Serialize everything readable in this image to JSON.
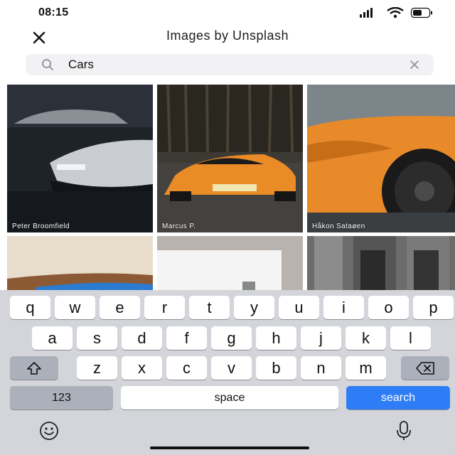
{
  "status_bar": {
    "time": "08:15",
    "icons": [
      "signal-icon",
      "wifi-icon",
      "battery-icon"
    ]
  },
  "header": {
    "title": "Images by Unsplash",
    "close_icon": "close-icon"
  },
  "search": {
    "value": "Cars",
    "icon": "search-icon",
    "clear_icon": "clear-icon"
  },
  "photos": [
    {
      "credit": "Peter Broomfield"
    },
    {
      "credit": "Marcus P."
    },
    {
      "credit": "Håkon Sataøen"
    },
    {
      "credit": ""
    },
    {
      "credit": ""
    },
    {
      "credit": ""
    }
  ],
  "keyboard": {
    "row1": [
      "q",
      "w",
      "e",
      "r",
      "t",
      "y",
      "u",
      "i",
      "o",
      "p"
    ],
    "row2": [
      "a",
      "s",
      "d",
      "f",
      "g",
      "h",
      "j",
      "k",
      "l"
    ],
    "row3": [
      "z",
      "x",
      "c",
      "v",
      "b",
      "n",
      "m"
    ],
    "shift_icon": "shift-icon",
    "backspace_icon": "backspace-icon",
    "numbers_label": "123",
    "space_label": "space",
    "search_label": "search",
    "emoji_icon": "emoji-icon",
    "mic_icon": "microphone-icon",
    "colors": {
      "background": "#d3d5db",
      "key": "#ffffff",
      "function_key": "#abb0ba",
      "search_key": "#2f7df6"
    }
  }
}
